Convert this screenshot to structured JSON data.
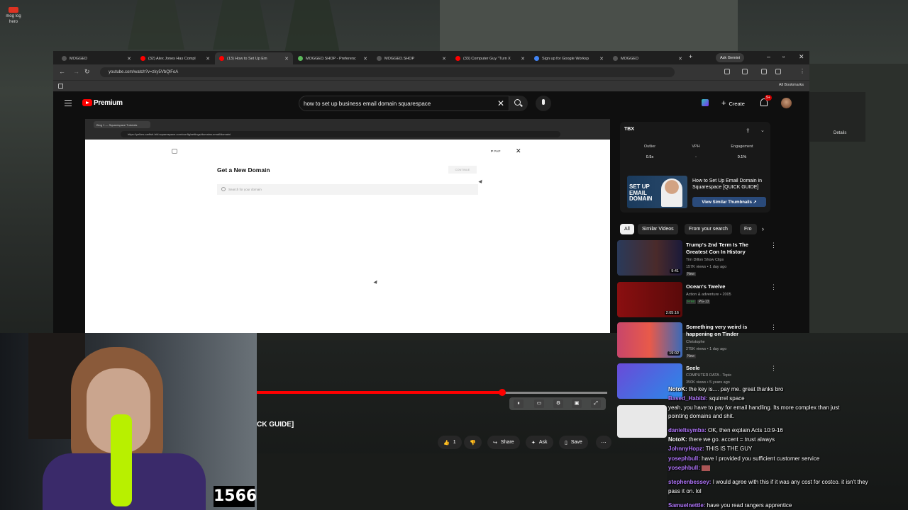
{
  "desktop": {
    "icon_label": "mog log hero"
  },
  "browser": {
    "tabs": [
      {
        "label": "MOGGED",
        "color": "#555"
      },
      {
        "label": "(32) Alex Jones Has Compl",
        "color": "#f00"
      },
      {
        "label": "(13) How to Set Up Em",
        "color": "#f00"
      },
      {
        "label": "MOGGED.SHOP - Preferenc",
        "color": "#5bb85b"
      },
      {
        "label": "MOGGED.SHOP",
        "color": "#555"
      },
      {
        "label": "(33) Computer Guy \"Turn X",
        "color": "#f00"
      },
      {
        "label": "Sign up for Google Worksp",
        "color": "#4285f4"
      },
      {
        "label": "MOGGED",
        "color": "#555"
      }
    ],
    "gemini_label": "Ask Gemini",
    "url": "youtube.com/watch?v=zky5VbQlFoA",
    "all_bookmarks": "All Bookmarks"
  },
  "youtube": {
    "premium_label": "Premium",
    "search_value": "how to set up business email domain squarespace",
    "create_label": "Create",
    "notif_count": "9+"
  },
  "video": {
    "inner_tab": "Blog 1 — Squarespace Tutorials",
    "inner_url": "https://yellow-carfish-lxkl.squarespace.com/config/settings/domains-email/domaini",
    "dialog_title": "Get a New Domain",
    "search_placeholder": "Search for your domain",
    "continue_label": "CONTINUE",
    "php_label": "₱ PHP",
    "progress": 0.7,
    "title_fragment": "CK GUIDE]"
  },
  "actions": {
    "like_count": "1",
    "share": "Share",
    "ask": "Ask",
    "save": "Save"
  },
  "stats": {
    "logo": "TBX",
    "outlier_label": "Outlier",
    "outlier_value": "0.5x",
    "vph_label": "VPH",
    "vph_value": "-",
    "engagement_label": "Engagement",
    "engagement_value": "0.1%",
    "promo_thumb_text": "SET UP EMAIL DOMAIN",
    "promo_title": "How to Set Up Email Domain in Squarespace [QUICK GUIDE]",
    "view_similar": "View Similar Thumbnails"
  },
  "chips": [
    "All",
    "Similar Videos",
    "From your search",
    "Fro"
  ],
  "recommendations": [
    {
      "title": "Trump's 2nd Term Is The Greatest Con In History",
      "channel": "Tim Dillon Show Clips",
      "meta": "157K views • 1 day ago",
      "tag": "New",
      "duration": "9:41"
    },
    {
      "title": "Ocean's Twelve",
      "channel": "Action & adventure • 2005",
      "meta": "Free",
      "tag": "PG-13",
      "duration": "2:05:16"
    },
    {
      "title": "Something very weird is happening on Tinder",
      "channel": "Christophe",
      "meta": "275K views • 1 day ago",
      "tag": "New",
      "duration": "19:02"
    },
    {
      "title": "Seele",
      "channel": "COMPUTER DATA - Topic",
      "meta": "350K views • 5 years ago",
      "tag": "",
      "duration": ""
    }
  ],
  "stream": {
    "counter": "1566"
  },
  "chat": [
    {
      "user": "NotoK:",
      "text": "the key is.... pay me. great thanks bro",
      "color": "#fff"
    },
    {
      "user": "Based_Habibi:",
      "text": "squirrel space",
      "color": "#b377ff"
    },
    {
      "user": "",
      "text": "yeah, you have to pay for email handling. Its more complex than just",
      "color": "#fff"
    },
    {
      "user": "",
      "text": "pointing domains and shit.",
      "color": "#fff"
    },
    {
      "user": "danieltsymba:",
      "text": "OK, then explain Acts 10:9-16",
      "color": "#b377ff"
    },
    {
      "user": "NotoK:",
      "text": "there we go. accent = trust always",
      "color": "#fff"
    },
    {
      "user": "JohnnyHopz:",
      "text": "THIS IS THE GUY",
      "color": "#b377ff"
    },
    {
      "user": "yosephbull:",
      "text": "have I provided you sufficient customer service",
      "color": "#b377ff"
    },
    {
      "user": "yosephbull:",
      "text": "",
      "color": "#b377ff"
    },
    {
      "user": "stephenbessey:",
      "text": "I would agree with this if it was any cost for costco. it isn't they",
      "color": "#b377ff"
    },
    {
      "user": "",
      "text": "pass it on. lol",
      "color": "#fff"
    },
    {
      "user": "Samuelnettle:",
      "text": "have you read rangers apprentice",
      "color": "#b377ff"
    }
  ],
  "side_window": {
    "details": "Details"
  }
}
